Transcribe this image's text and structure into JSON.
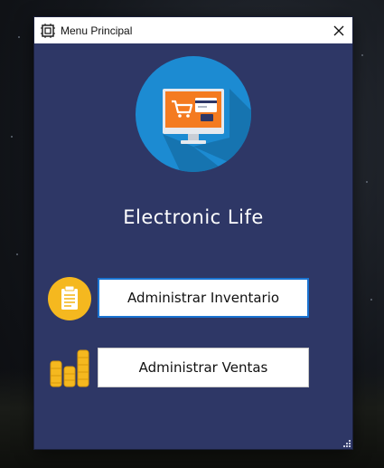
{
  "window": {
    "title": "Menu Principal"
  },
  "brand": {
    "name": "Electronic Life"
  },
  "menu": {
    "inventory_label": "Administrar Inventario",
    "sales_label": "Administrar Ventas"
  },
  "colors": {
    "window_bg": "#2e3766",
    "logo_circle": "#1c8bd2",
    "monitor_screen": "#f47b20",
    "accent_gold": "#f5b81f",
    "focus_border": "#1a73d1"
  },
  "icons": {
    "app": "app-window-icon",
    "close": "close-icon",
    "logo": "monitor-cart-icon",
    "inventory": "clipboard-icon",
    "sales": "coins-stack-icon"
  }
}
